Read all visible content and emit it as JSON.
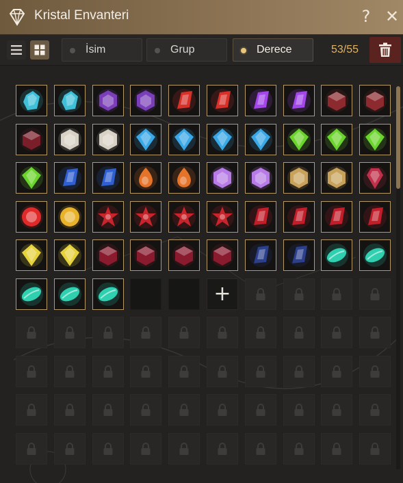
{
  "window": {
    "title": "Kristal Envanteri",
    "title_icon": "diamond-icon",
    "help_label": "?",
    "close_label": "✕"
  },
  "toolbar": {
    "view_list_icon": "list-view-icon",
    "view_grid_icon": "grid-view-icon",
    "sort_tabs": [
      {
        "label": "İsim",
        "active": false
      },
      {
        "label": "Grup",
        "active": false
      },
      {
        "label": "Derece",
        "active": true
      }
    ],
    "count": "53/55",
    "trash_icon": "trash-icon"
  },
  "grid": {
    "columns": 10,
    "add_label": "+",
    "slots": [
      {
        "state": "filled",
        "gem": "cyan-crystal",
        "color": "#3fc0d8"
      },
      {
        "state": "filled",
        "gem": "cyan-crystal",
        "color": "#3fc0d8"
      },
      {
        "state": "filled",
        "gem": "purple-hexagon",
        "color": "#7a3fb8"
      },
      {
        "state": "filled",
        "gem": "purple-hexagon",
        "color": "#7a3fb8"
      },
      {
        "state": "filled",
        "gem": "red-shard",
        "color": "#d8312a"
      },
      {
        "state": "filled",
        "gem": "red-shard",
        "color": "#d8312a"
      },
      {
        "state": "filled",
        "gem": "violet-shard",
        "color": "#a447ea"
      },
      {
        "state": "filled",
        "gem": "violet-shard",
        "color": "#a447ea"
      },
      {
        "state": "filled",
        "gem": "dark-red-ring",
        "color": "#8c2a2f"
      },
      {
        "state": "filled",
        "gem": "dark-red-ring",
        "color": "#8c2a2f"
      },
      {
        "state": "filled",
        "gem": "dark-red-ring",
        "color": "#7a1f2a"
      },
      {
        "state": "filled",
        "gem": "white-hexagon",
        "color": "#d8d2c6"
      },
      {
        "state": "filled",
        "gem": "white-hexagon",
        "color": "#d8d2c6"
      },
      {
        "state": "filled",
        "gem": "blue-kite",
        "color": "#3aa7e6"
      },
      {
        "state": "filled",
        "gem": "blue-kite",
        "color": "#3aa7e6"
      },
      {
        "state": "filled",
        "gem": "blue-kite",
        "color": "#3aa7e6"
      },
      {
        "state": "filled",
        "gem": "blue-kite",
        "color": "#3aa7e6"
      },
      {
        "state": "filled",
        "gem": "green-kite",
        "color": "#6bd42c"
      },
      {
        "state": "filled",
        "gem": "green-kite",
        "color": "#6bd42c"
      },
      {
        "state": "filled",
        "gem": "green-kite",
        "color": "#6bd42c"
      },
      {
        "state": "filled",
        "gem": "green-kite",
        "color": "#6bd42c"
      },
      {
        "state": "filled",
        "gem": "sapphire",
        "color": "#2f5fd0"
      },
      {
        "state": "filled",
        "gem": "sapphire",
        "color": "#2f5fd0"
      },
      {
        "state": "filled",
        "gem": "orange-drop",
        "color": "#e5742a"
      },
      {
        "state": "filled",
        "gem": "orange-drop",
        "color": "#e5742a"
      },
      {
        "state": "filled",
        "gem": "lilac-hexagon",
        "color": "#b77ae6"
      },
      {
        "state": "filled",
        "gem": "lilac-hexagon",
        "color": "#b77ae6"
      },
      {
        "state": "filled",
        "gem": "gold-hexagon",
        "color": "#c8a25a"
      },
      {
        "state": "filled",
        "gem": "gold-hexagon",
        "color": "#c8a25a"
      },
      {
        "state": "filled",
        "gem": "ruby-pendant",
        "color": "#c0304a"
      },
      {
        "state": "filled",
        "gem": "red-orb",
        "color": "#e02a2a"
      },
      {
        "state": "filled",
        "gem": "gold-orb",
        "color": "#e8b22a"
      },
      {
        "state": "filled",
        "gem": "red-star",
        "color": "#c8242c"
      },
      {
        "state": "filled",
        "gem": "red-star",
        "color": "#c8242c"
      },
      {
        "state": "filled",
        "gem": "red-star",
        "color": "#c8242c"
      },
      {
        "state": "filled",
        "gem": "red-star",
        "color": "#c8242c"
      },
      {
        "state": "filled",
        "gem": "ruby",
        "color": "#c21e2a"
      },
      {
        "state": "filled",
        "gem": "ruby",
        "color": "#c21e2a"
      },
      {
        "state": "filled",
        "gem": "ruby",
        "color": "#c21e2a"
      },
      {
        "state": "filled",
        "gem": "ruby",
        "color": "#c21e2a"
      },
      {
        "state": "filled",
        "gem": "yellow-diamond",
        "color": "#e6d23a"
      },
      {
        "state": "filled",
        "gem": "yellow-diamond",
        "color": "#e6d23a"
      },
      {
        "state": "filled",
        "gem": "garnet-cube",
        "color": "#8a1a2e"
      },
      {
        "state": "filled",
        "gem": "garnet-cube",
        "color": "#8a1a2e"
      },
      {
        "state": "filled",
        "gem": "garnet-cube",
        "color": "#8a1a2e"
      },
      {
        "state": "filled",
        "gem": "garnet-cube",
        "color": "#8a1a2e"
      },
      {
        "state": "filled",
        "gem": "navy-shard",
        "color": "#2b3f8c"
      },
      {
        "state": "filled",
        "gem": "navy-shard",
        "color": "#2b3f8c"
      },
      {
        "state": "filled",
        "gem": "teal-leaf",
        "color": "#2fcfb0"
      },
      {
        "state": "filled",
        "gem": "teal-leaf",
        "color": "#2fcfb0"
      },
      {
        "state": "filled",
        "gem": "teal-leaf",
        "color": "#2fcfb0"
      },
      {
        "state": "filled",
        "gem": "teal-leaf",
        "color": "#2fcfb0"
      },
      {
        "state": "filled",
        "gem": "teal-leaf",
        "color": "#2fcfb0"
      },
      {
        "state": "empty"
      },
      {
        "state": "empty"
      },
      {
        "state": "add"
      },
      {
        "state": "locked"
      },
      {
        "state": "locked"
      },
      {
        "state": "locked"
      },
      {
        "state": "locked"
      },
      {
        "state": "locked"
      },
      {
        "state": "locked"
      },
      {
        "state": "locked"
      },
      {
        "state": "locked"
      },
      {
        "state": "locked"
      },
      {
        "state": "locked"
      },
      {
        "state": "locked"
      },
      {
        "state": "locked"
      },
      {
        "state": "locked"
      },
      {
        "state": "locked"
      },
      {
        "state": "locked"
      },
      {
        "state": "locked"
      },
      {
        "state": "locked"
      },
      {
        "state": "locked"
      },
      {
        "state": "locked"
      },
      {
        "state": "locked"
      },
      {
        "state": "locked"
      },
      {
        "state": "locked"
      },
      {
        "state": "locked"
      },
      {
        "state": "locked"
      },
      {
        "state": "locked"
      },
      {
        "state": "locked"
      },
      {
        "state": "locked"
      },
      {
        "state": "locked"
      },
      {
        "state": "locked"
      },
      {
        "state": "locked"
      },
      {
        "state": "locked"
      },
      {
        "state": "locked"
      },
      {
        "state": "locked"
      },
      {
        "state": "locked"
      },
      {
        "state": "locked"
      },
      {
        "state": "locked"
      },
      {
        "state": "locked"
      },
      {
        "state": "locked"
      },
      {
        "state": "locked"
      },
      {
        "state": "locked"
      },
      {
        "state": "locked"
      },
      {
        "state": "locked"
      },
      {
        "state": "locked"
      },
      {
        "state": "locked"
      }
    ]
  },
  "scrollbar": {
    "position": 0.0
  }
}
